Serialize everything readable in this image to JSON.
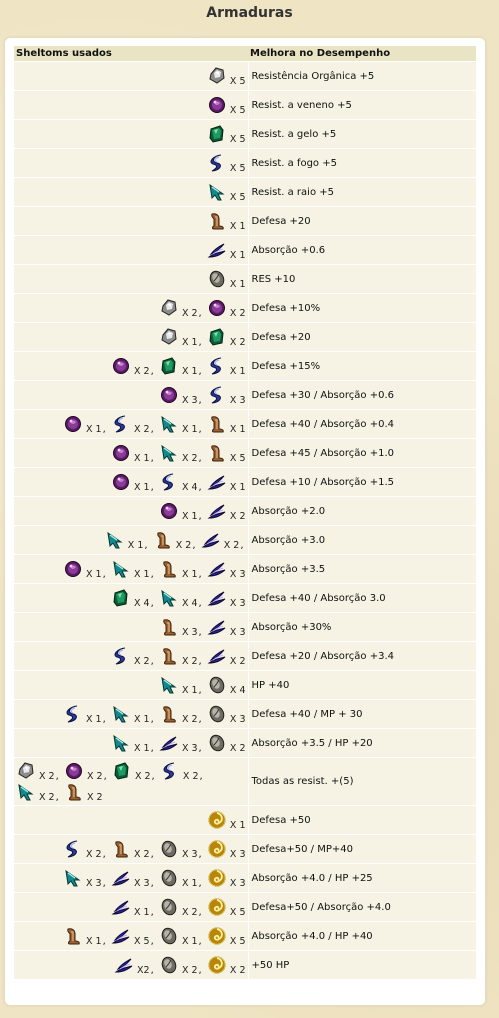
{
  "page_title": "Armaduras",
  "headers": {
    "left": "Sheltoms usados",
    "right": "Melhora no Desempenho"
  },
  "rows": [
    {
      "items": [
        {
          "gem": "lucidy",
          "qty": "X 5"
        }
      ],
      "effect": "Resistência Orgânica +5"
    },
    {
      "items": [
        {
          "gem": "sereno",
          "qty": "X 5"
        }
      ],
      "effect": "Resist. a veneno +5"
    },
    {
      "items": [
        {
          "gem": "fadeo",
          "qty": "X 5"
        }
      ],
      "effect": "Resist. a gelo +5"
    },
    {
      "items": [
        {
          "gem": "sparky",
          "qty": "X 5"
        }
      ],
      "effect": "Resist. a fogo +5"
    },
    {
      "items": [
        {
          "gem": "raident",
          "qty": "X 5"
        }
      ],
      "effect": "Resist. a raio +5"
    },
    {
      "items": [
        {
          "gem": "transparo",
          "qty": "X 1"
        }
      ],
      "effect": "Defesa +20"
    },
    {
      "items": [
        {
          "gem": "murky",
          "qty": "X 1"
        }
      ],
      "effect": "Absorção +0.6"
    },
    {
      "items": [
        {
          "gem": "devine",
          "qty": "X 1"
        }
      ],
      "effect": "RES +10"
    },
    {
      "items": [
        {
          "gem": "lucidy",
          "qty": "X 2"
        },
        {
          "gem": "sereno",
          "qty": "X 2"
        }
      ],
      "effect": "Defesa +10%"
    },
    {
      "items": [
        {
          "gem": "lucidy",
          "qty": "X 1"
        },
        {
          "gem": "fadeo",
          "qty": "X 2"
        }
      ],
      "effect": "Defesa +20"
    },
    {
      "items": [
        {
          "gem": "sereno",
          "qty": "X 2"
        },
        {
          "gem": "fadeo",
          "qty": "X 1"
        },
        {
          "gem": "sparky",
          "qty": "X 1"
        }
      ],
      "effect": "Defesa +15%"
    },
    {
      "items": [
        {
          "gem": "sereno",
          "qty": "X 3"
        },
        {
          "gem": "sparky",
          "qty": "X 3"
        }
      ],
      "effect": "Defesa +30 / Absorção +0.6"
    },
    {
      "items": [
        {
          "gem": "sereno",
          "qty": "X 1"
        },
        {
          "gem": "sparky",
          "qty": "X 2"
        },
        {
          "gem": "raident",
          "qty": "X 1"
        },
        {
          "gem": "transparo",
          "qty": "X 1"
        }
      ],
      "effect": "Defesa +40 / Absorção +0.4"
    },
    {
      "items": [
        {
          "gem": "sereno",
          "qty": "X 1"
        },
        {
          "gem": "raident",
          "qty": "X 2"
        },
        {
          "gem": "transparo",
          "qty": "X 5"
        }
      ],
      "effect": "Defesa +45 / Absorção +1.0"
    },
    {
      "items": [
        {
          "gem": "sereno",
          "qty": "X 1"
        },
        {
          "gem": "sparky",
          "qty": "X 4"
        },
        {
          "gem": "murky",
          "qty": "X 1"
        }
      ],
      "effect": "Defesa +10 / Absorção +1.5"
    },
    {
      "items": [
        {
          "gem": "sereno",
          "qty": "X 1"
        },
        {
          "gem": "murky",
          "qty": "X 2"
        }
      ],
      "effect": "Absorção +2.0"
    },
    {
      "items": [
        {
          "gem": "raident",
          "qty": "X 1"
        },
        {
          "gem": "transparo",
          "qty": "X 2"
        },
        {
          "gem": "murky",
          "qty": "X 2"
        }
      ],
      "trailing_comma": true,
      "effect": "Absorção +3.0"
    },
    {
      "items": [
        {
          "gem": "sereno",
          "qty": "X 1"
        },
        {
          "gem": "raident",
          "qty": "X 1"
        },
        {
          "gem": "transparo",
          "qty": "X 1"
        },
        {
          "gem": "murky",
          "qty": "X 3"
        }
      ],
      "effect": "Absorção +3.5"
    },
    {
      "items": [
        {
          "gem": "fadeo",
          "qty": "X 4"
        },
        {
          "gem": "raident",
          "qty": "X 4"
        },
        {
          "gem": "murky",
          "qty": "X 3"
        }
      ],
      "effect": "Defesa +40 / Absorção 3.0"
    },
    {
      "items": [
        {
          "gem": "transparo",
          "qty": "X 3"
        },
        {
          "gem": "murky",
          "qty": "X 3"
        }
      ],
      "effect": "Absorção +30%"
    },
    {
      "items": [
        {
          "gem": "sparky",
          "qty": "X 2"
        },
        {
          "gem": "transparo",
          "qty": "X 2"
        },
        {
          "gem": "murky",
          "qty": "X 2"
        }
      ],
      "effect": "Defesa +20 / Absorção +3.4"
    },
    {
      "items": [
        {
          "gem": "raident",
          "qty": "X 1"
        },
        {
          "gem": "devine",
          "qty": "X 4"
        }
      ],
      "effect": "HP +40"
    },
    {
      "items": [
        {
          "gem": "sparky",
          "qty": "X 1"
        },
        {
          "gem": "raident",
          "qty": "X 1"
        },
        {
          "gem": "transparo",
          "qty": "X 2"
        },
        {
          "gem": "devine",
          "qty": "X 3"
        }
      ],
      "effect": "Defesa +40 / MP + 30"
    },
    {
      "items": [
        {
          "gem": "raident",
          "qty": "X 1"
        },
        {
          "gem": "murky",
          "qty": "X 3"
        },
        {
          "gem": "devine",
          "qty": "X 2"
        }
      ],
      "effect": "Absorção +3.5 / HP +20"
    },
    {
      "items": [
        {
          "gem": "lucidy",
          "qty": "X 2"
        },
        {
          "gem": "sereno",
          "qty": "X 2"
        },
        {
          "gem": "fadeo",
          "qty": "X 2"
        },
        {
          "gem": "sparky",
          "qty": "X 2"
        },
        {
          "gem": "raident",
          "qty": "X 2"
        },
        {
          "gem": "transparo",
          "qty": "X 2"
        }
      ],
      "wrap": true,
      "effect": "Todas as resist. +(5)"
    },
    {
      "items": [
        {
          "gem": "celesto",
          "qty": "X 1"
        }
      ],
      "effect": "Defesa +50"
    },
    {
      "items": [
        {
          "gem": "sparky",
          "qty": "X 2"
        },
        {
          "gem": "transparo",
          "qty": "X 2"
        },
        {
          "gem": "devine",
          "qty": "X 3"
        },
        {
          "gem": "celesto",
          "qty": "X 3"
        }
      ],
      "effect": "Defesa+50 / MP+40"
    },
    {
      "items": [
        {
          "gem": "raident",
          "qty": "X 3"
        },
        {
          "gem": "murky",
          "qty": "X 3"
        },
        {
          "gem": "devine",
          "qty": "X 1"
        },
        {
          "gem": "celesto",
          "qty": "X 3"
        }
      ],
      "effect": "Absorção +4.0 / HP +25"
    },
    {
      "items": [
        {
          "gem": "murky",
          "qty": "X 1"
        },
        {
          "gem": "devine",
          "qty": "X 2"
        },
        {
          "gem": "celesto",
          "qty": "X 5"
        }
      ],
      "effect": "Defesa+50 / Absorção +4.0"
    },
    {
      "items": [
        {
          "gem": "transparo",
          "qty": "X 1"
        },
        {
          "gem": "murky",
          "qty": "X 5"
        },
        {
          "gem": "devine",
          "qty": "X 1"
        },
        {
          "gem": "celesto",
          "qty": "X 5"
        }
      ],
      "effect": "Absorção +4.0 / HP +40"
    },
    {
      "items": [
        {
          "gem": "murky",
          "qty": "X2"
        },
        {
          "gem": "devine",
          "qty": "X 2"
        },
        {
          "gem": "celesto",
          "qty": "X 2"
        }
      ],
      "effect": "+50 HP"
    }
  ]
}
